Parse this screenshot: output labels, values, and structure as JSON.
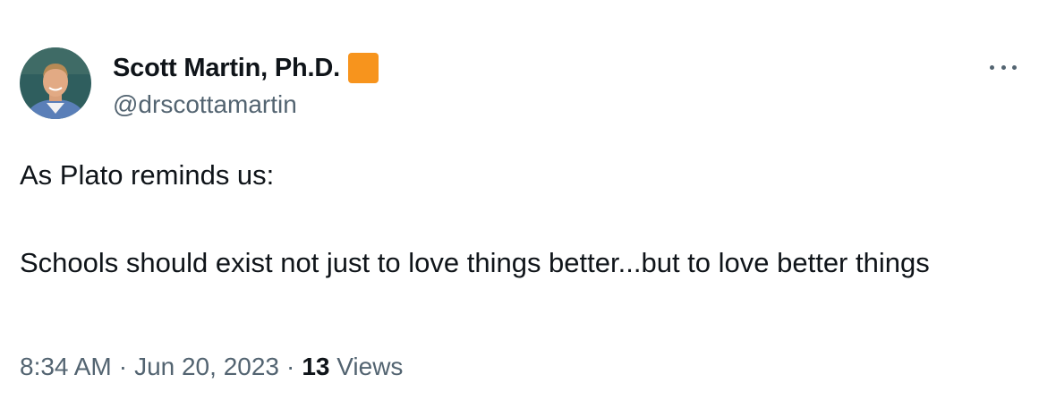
{
  "author": {
    "display_name": "Scott Martin, Ph.D.",
    "handle": "@drscottamartin",
    "badge_color": "#f7941d"
  },
  "tweet": {
    "lines": [
      "As Plato reminds us:",
      "Schools should exist not just to love things better...but to love better things"
    ]
  },
  "meta": {
    "time": "8:34 AM",
    "separator": "·",
    "date": "Jun 20, 2023",
    "views_count": "13",
    "views_label": "Views"
  },
  "icons": {
    "more": "more-options-icon",
    "avatar": "profile-photo"
  },
  "colors": {
    "text_primary": "#0f1419",
    "text_secondary": "#536471"
  }
}
